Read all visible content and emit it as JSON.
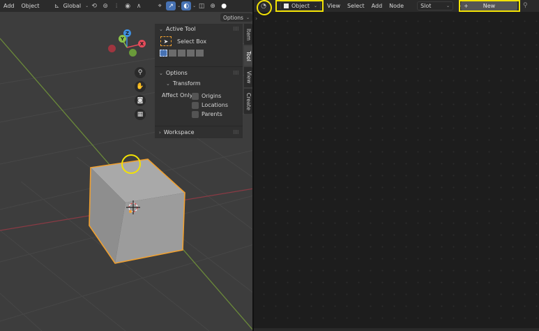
{
  "viewport": {
    "header": {
      "menu_add": "Add",
      "menu_object": "Object",
      "transform_orientation": "Global"
    },
    "options_label": "Options",
    "gizmo": {
      "x_label": "X",
      "y_label": "Y",
      "z_label": "Z"
    },
    "npanel": {
      "active_tool_title": "Active Tool",
      "select_box_label": "Select Box",
      "options_title": "Options",
      "transform_title": "Transform",
      "affect_only_label": "Affect Only",
      "affect_origins": "Origins",
      "affect_locations": "Locations",
      "affect_parents": "Parents",
      "workspace_title": "Workspace"
    },
    "tabs": [
      "Item",
      "Tool",
      "View",
      "Create"
    ],
    "active_tab": "Tool"
  },
  "shader_editor": {
    "object_mode_label": "Object",
    "menu": [
      "View",
      "Select",
      "Add",
      "Node"
    ],
    "slot_label": "Slot",
    "new_label": "New",
    "new_plus": "+"
  },
  "colors": {
    "highlight": "#f2e205",
    "axis_x": "#e44b5a",
    "axis_y": "#8bc34a",
    "axis_z": "#3f8fe0",
    "selection_outline": "#f0a030",
    "active_blue": "#4772b3"
  }
}
